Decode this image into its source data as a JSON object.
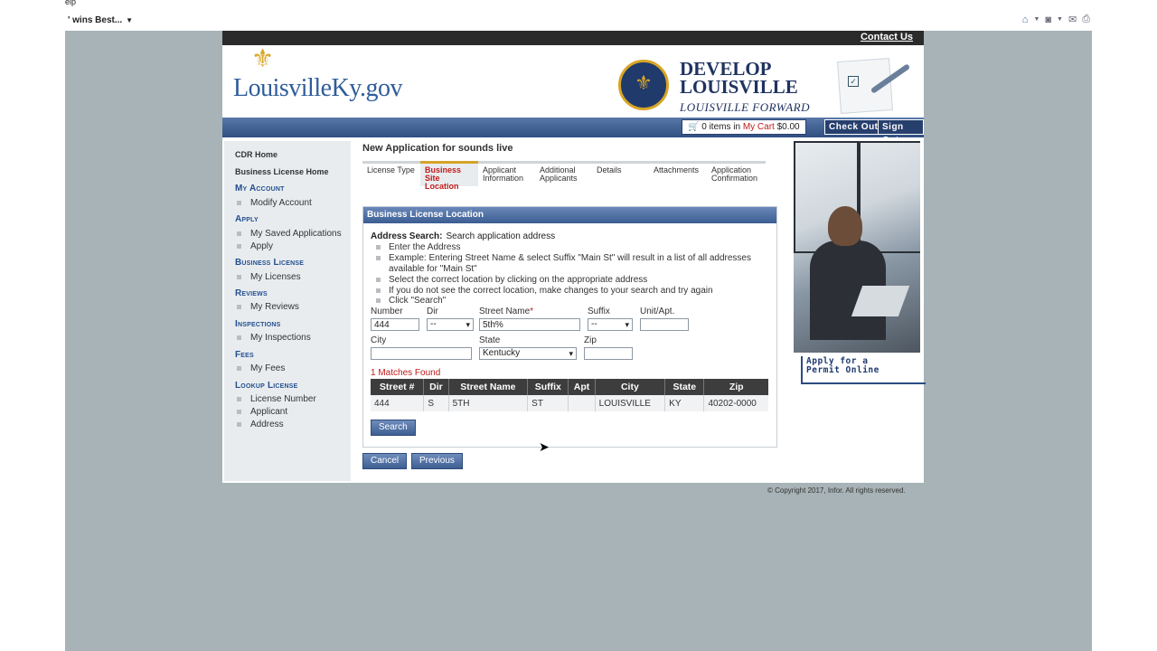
{
  "browser": {
    "menu_fragment": "elp",
    "favorite": "' wins Best...",
    "icons": [
      "home-icon",
      "rss-icon",
      "mail-icon",
      "print-icon"
    ]
  },
  "header": {
    "contact": "Contact Us",
    "logo": "LouisvilleKy.gov",
    "develop": "DEVELOP\nLOUISVILLE",
    "develop_line1": "DEVELOP",
    "develop_line2": "LOUISVILLE",
    "forward": "LOUISVILLE FORWARD",
    "cart_count": "0",
    "cart_items_text": "items in",
    "cart_link": "My Cart",
    "cart_total": "$0.00",
    "checkout": "Check Out",
    "signout": "Sign Out"
  },
  "sidebar": {
    "cdr_home": "CDR Home",
    "bl_home": "Business License Home",
    "my_account": "My Account",
    "modify_account": "Modify Account",
    "apply": "Apply",
    "saved_apps": "My Saved Applications",
    "apply_item": "Apply",
    "business_license": "Business License",
    "my_licenses": "My Licenses",
    "reviews": "Reviews",
    "my_reviews": "My Reviews",
    "inspections": "Inspections",
    "my_inspections": "My Inspections",
    "fees": "Fees",
    "my_fees": "My Fees",
    "lookup_license": "Lookup License",
    "license_number": "License Number",
    "applicant": "Applicant",
    "address": "Address"
  },
  "main": {
    "title": "New Application for sounds live",
    "steps": {
      "s1": "License Type",
      "s2": "Business Site Location",
      "s3": "Applicant Information",
      "s4": "Additional Applicants",
      "s5": "Details",
      "s6": "Attachments",
      "s7": "Application Confirmation"
    },
    "panel_title": "Business License Location",
    "address_search_label": "Address Search:",
    "address_search_text": "Search application address",
    "instructions": {
      "i1": "Enter the Address",
      "i2": "Example: Entering Street Name & select Suffix \"Main St\" will result in a list of all addresses",
      "i2b": "available for \"Main St\"",
      "i3": "Select the correct location by clicking on the appropriate address",
      "i4": "If you do not see the correct location, make changes to your search and try again",
      "i5": "Click \"Search\""
    },
    "fields": {
      "number_label": "Number",
      "number_value": "444",
      "dir_label": "Dir",
      "dir_value": "--",
      "street_label": "Street Name",
      "street_value": "5th%",
      "suffix_label": "Suffix",
      "suffix_value": "--",
      "unit_label": "Unit/Apt.",
      "unit_value": "",
      "city_label": "City",
      "city_value": "",
      "state_label": "State",
      "state_value": "Kentucky",
      "zip_label": "Zip",
      "zip_value": ""
    },
    "matches": "1 Matches Found",
    "table": {
      "headers": [
        "Street #",
        "Dir",
        "Street Name",
        "Suffix",
        "Apt",
        "City",
        "State",
        "Zip"
      ],
      "rows": [
        [
          "444",
          "S",
          "5TH",
          "ST",
          "",
          "LOUISVILLE",
          "KY",
          "40202-0000"
        ]
      ]
    },
    "search_btn": "Search",
    "cancel_btn": "Cancel",
    "previous_btn": "Previous"
  },
  "aside": {
    "apply_line1": "Apply for a",
    "apply_line2": "Permit Online"
  },
  "footer": {
    "copyright": "© Copyright 2017, Infor. All rights reserved."
  },
  "colors": {
    "accent_blue": "#2f4f82",
    "highlight_red": "#c01b1b",
    "gold": "#d4a427",
    "viewport_gray": "#a7b3b6"
  }
}
